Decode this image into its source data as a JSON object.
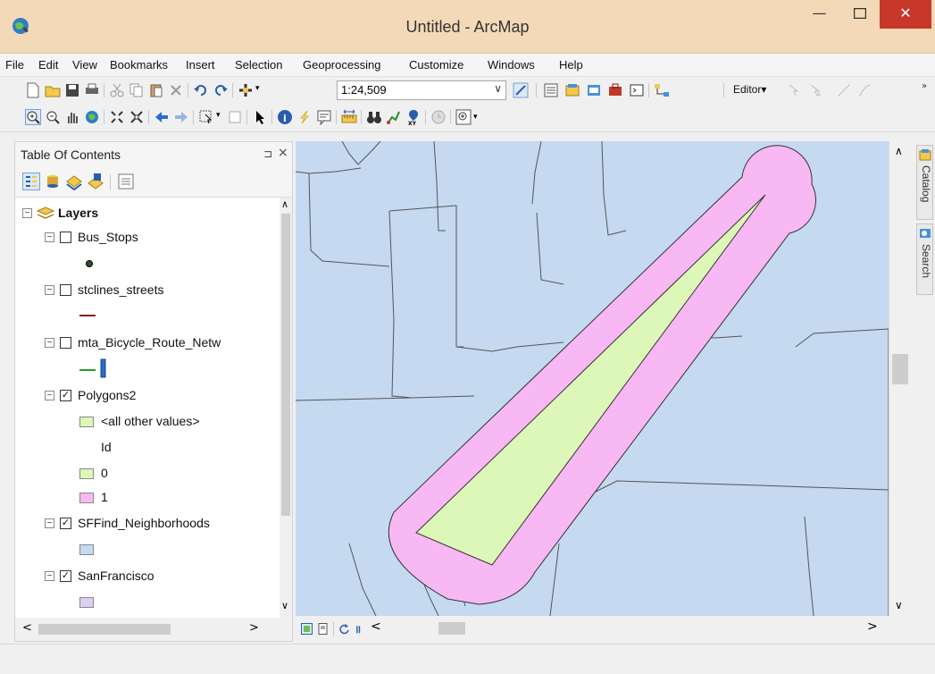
{
  "window": {
    "title": "Untitled - ArcMap",
    "min_symbol": "—",
    "close_symbol": "✕"
  },
  "menu": [
    "File",
    "Edit",
    "View",
    "Bookmarks",
    "Insert",
    "Selection",
    "Geoprocessing",
    "Customize",
    "Windows",
    "Help"
  ],
  "toolbar": {
    "scale": "1:24,509",
    "editor_label": "Editor▾"
  },
  "toc": {
    "title": "Table Of Contents",
    "pin_symbol": "⊐",
    "close_symbol": "×",
    "root_label": "Layers",
    "layers": [
      {
        "name": "Bus_Stops",
        "checked": false
      },
      {
        "name": "stclines_streets",
        "checked": false
      },
      {
        "name": "mta_Bicycle_Route_Netw",
        "checked": false
      },
      {
        "name": "Polygons2",
        "checked": true
      },
      {
        "name": "SFFind_Neighborhoods",
        "checked": true
      },
      {
        "name": "SanFrancisco",
        "checked": true
      }
    ],
    "polygons2_legend": {
      "all_other": "<all other values>",
      "field": "Id",
      "value0": "0",
      "value1": "1"
    }
  },
  "dock": {
    "catalog": "Catalog",
    "search": "Search"
  },
  "colors": {
    "map_bg": "#c5d9f1",
    "buffer": "#f8b8f4",
    "wedge": "#dcf7b7",
    "neighborhood": "#c5d9f1",
    "sanfrancisco": "#dcd0f0",
    "close_red": "#c7382b"
  }
}
